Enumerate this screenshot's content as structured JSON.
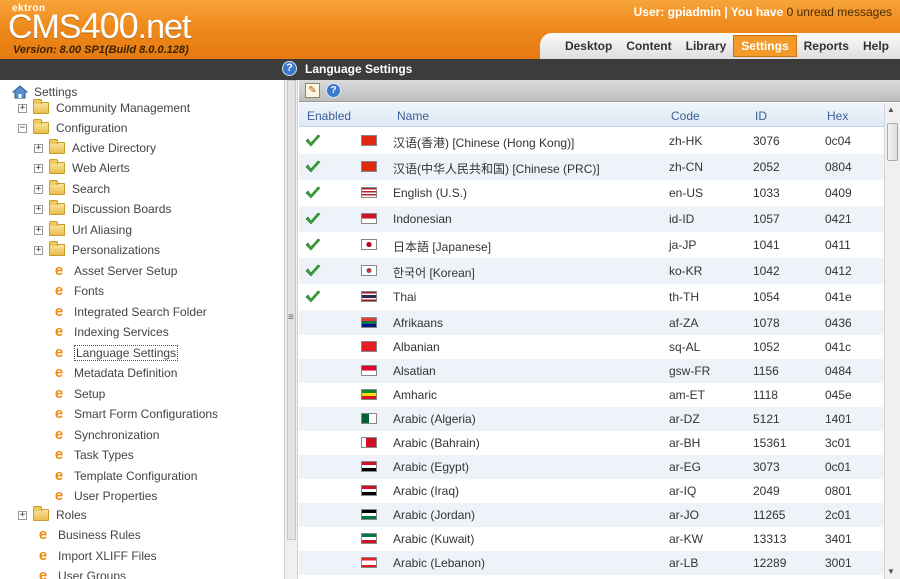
{
  "header": {
    "logo_small": "ektron",
    "logo_cms": "CMS",
    "logo_400": "400",
    "logo_net": ".net",
    "version": "Version: 8.00 SP1(Build 8.0.0.128)",
    "user_prefix": "User: gpiadmin | You have ",
    "unread": "0 unread messages",
    "accent_color": "#f39a28"
  },
  "nav": {
    "items": [
      "Desktop",
      "Content",
      "Library",
      "Settings",
      "Reports",
      "Help"
    ],
    "active": "Settings"
  },
  "title_bar": {
    "title": "Language Settings",
    "help_icon": "help-icon"
  },
  "tree": {
    "root": "Settings",
    "items": [
      {
        "label": "Community Management",
        "level": 1,
        "type": "folder",
        "expander": "+"
      },
      {
        "label": "Configuration",
        "level": 1,
        "type": "folder",
        "expander": "−"
      },
      {
        "label": "Active Directory",
        "level": 2,
        "type": "folder",
        "expander": "+"
      },
      {
        "label": "Web Alerts",
        "level": 2,
        "type": "folder",
        "expander": "+"
      },
      {
        "label": "Search",
        "level": 2,
        "type": "folder",
        "expander": "+"
      },
      {
        "label": "Discussion Boards",
        "level": 2,
        "type": "folder",
        "expander": "+"
      },
      {
        "label": "Url Aliasing",
        "level": 2,
        "type": "folder",
        "expander": "+"
      },
      {
        "label": "Personalizations",
        "level": 2,
        "type": "folder",
        "expander": "+"
      },
      {
        "label": "Asset Server Setup",
        "level": 2,
        "type": "page"
      },
      {
        "label": "Fonts",
        "level": 2,
        "type": "page"
      },
      {
        "label": "Integrated Search Folder",
        "level": 2,
        "type": "page"
      },
      {
        "label": "Indexing Services",
        "level": 2,
        "type": "page"
      },
      {
        "label": "Language Settings",
        "level": 2,
        "type": "page",
        "selected": true
      },
      {
        "label": "Metadata Definition",
        "level": 2,
        "type": "page"
      },
      {
        "label": "Setup",
        "level": 2,
        "type": "page"
      },
      {
        "label": "Smart Form Configurations",
        "level": 2,
        "type": "page"
      },
      {
        "label": "Synchronization",
        "level": 2,
        "type": "page"
      },
      {
        "label": "Task Types",
        "level": 2,
        "type": "page"
      },
      {
        "label": "Template Configuration",
        "level": 2,
        "type": "page"
      },
      {
        "label": "User Properties",
        "level": 2,
        "type": "page"
      },
      {
        "label": "Roles",
        "level": 1,
        "type": "folder",
        "expander": "+"
      },
      {
        "label": "Business Rules",
        "level": 1,
        "type": "page"
      },
      {
        "label": "Import XLIFF Files",
        "level": 1,
        "type": "page"
      },
      {
        "label": "User Groups",
        "level": 1,
        "type": "page"
      }
    ]
  },
  "grid": {
    "columns": [
      "Enabled",
      "Name",
      "Code",
      "ID",
      "Hex"
    ],
    "rows": [
      {
        "enabled": true,
        "flag": "hong-kong",
        "name": "汉语(香港) [Chinese (Hong Kong)]",
        "code": "zh-HK",
        "id": "3076",
        "hex": "0c04"
      },
      {
        "enabled": true,
        "flag": "china",
        "name": "汉语(中华人民共和国) [Chinese (PRC)]",
        "code": "zh-CN",
        "id": "2052",
        "hex": "0804"
      },
      {
        "enabled": true,
        "flag": "usa",
        "name": "English (U.S.)",
        "code": "en-US",
        "id": "1033",
        "hex": "0409"
      },
      {
        "enabled": true,
        "flag": "indonesia",
        "name": "Indonesian",
        "code": "id-ID",
        "id": "1057",
        "hex": "0421"
      },
      {
        "enabled": true,
        "flag": "japan",
        "name": "日本語 [Japanese]",
        "code": "ja-JP",
        "id": "1041",
        "hex": "0411"
      },
      {
        "enabled": true,
        "flag": "korea",
        "name": "한국어 [Korean]",
        "code": "ko-KR",
        "id": "1042",
        "hex": "0412"
      },
      {
        "enabled": true,
        "flag": "thailand",
        "name": "Thai",
        "code": "th-TH",
        "id": "1054",
        "hex": "041e"
      },
      {
        "enabled": false,
        "flag": "south-africa",
        "name": "Afrikaans",
        "code": "af-ZA",
        "id": "1078",
        "hex": "0436"
      },
      {
        "enabled": false,
        "flag": "albania",
        "name": "Albanian",
        "code": "sq-AL",
        "id": "1052",
        "hex": "041c"
      },
      {
        "enabled": false,
        "flag": "alsace",
        "name": "Alsatian",
        "code": "gsw-FR",
        "id": "1156",
        "hex": "0484"
      },
      {
        "enabled": false,
        "flag": "ethiopia",
        "name": "Amharic",
        "code": "am-ET",
        "id": "1118",
        "hex": "045e"
      },
      {
        "enabled": false,
        "flag": "algeria",
        "name": "Arabic (Algeria)",
        "code": "ar-DZ",
        "id": "5121",
        "hex": "1401"
      },
      {
        "enabled": false,
        "flag": "bahrain",
        "name": "Arabic (Bahrain)",
        "code": "ar-BH",
        "id": "15361",
        "hex": "3c01"
      },
      {
        "enabled": false,
        "flag": "egypt",
        "name": "Arabic (Egypt)",
        "code": "ar-EG",
        "id": "3073",
        "hex": "0c01"
      },
      {
        "enabled": false,
        "flag": "iraq",
        "name": "Arabic (Iraq)",
        "code": "ar-IQ",
        "id": "2049",
        "hex": "0801"
      },
      {
        "enabled": false,
        "flag": "jordan",
        "name": "Arabic (Jordan)",
        "code": "ar-JO",
        "id": "11265",
        "hex": "2c01"
      },
      {
        "enabled": false,
        "flag": "kuwait",
        "name": "Arabic (Kuwait)",
        "code": "ar-KW",
        "id": "13313",
        "hex": "3401"
      },
      {
        "enabled": false,
        "flag": "lebanon",
        "name": "Arabic (Lebanon)",
        "code": "ar-LB",
        "id": "12289",
        "hex": "3001"
      }
    ]
  }
}
